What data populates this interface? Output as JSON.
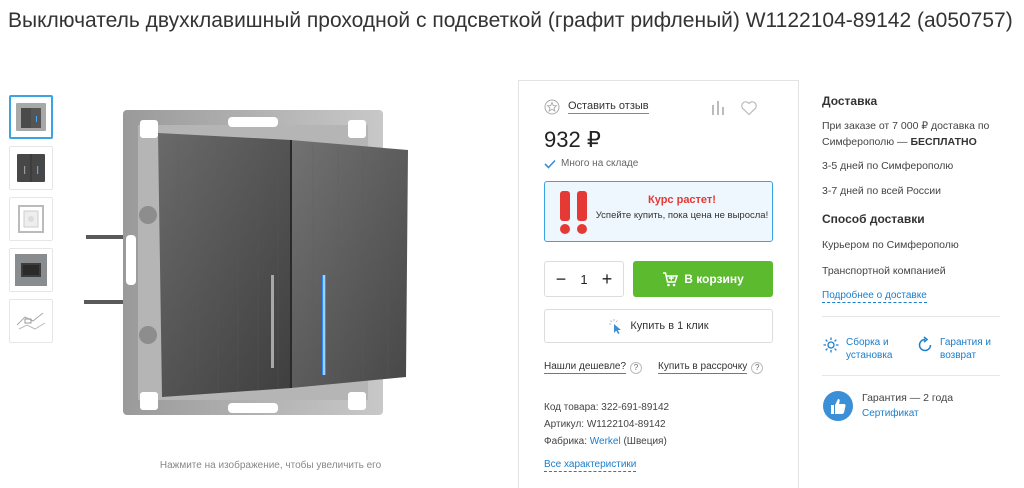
{
  "product": {
    "title": "Выключатель двухклавишный проходной с подсветкой (графит рифленый) W1122104-89142 (a050757)"
  },
  "gallery": {
    "thumbs": [
      "main-switch",
      "switch-front-lit",
      "frame-only",
      "switch-in-interior",
      "scheme"
    ],
    "active_index": 0,
    "caption": "Нажмите на изображение, чтобы увеличить его"
  },
  "buy": {
    "review_label": "Оставить отзыв",
    "price": "932 ₽",
    "stock": "Много на складе",
    "promo": {
      "title": "Курс растет!",
      "text": "Успейте купить, пока цена не выросла!"
    },
    "qty": "1",
    "minus": "−",
    "plus": "+",
    "cart_label": "В корзину",
    "oneclick_label": "Купить в 1 клик",
    "cheaper_label": "Нашли дешевле?",
    "installment_label": "Купить в рассрочку",
    "qmark": "?",
    "code_line": "Код товара: 322-691-89142",
    "article_line": "Артикул: W1122104-89142",
    "maker_prefix": "Фабрика: ",
    "maker_brand": "Werkel",
    "maker_country": " (Швеция)",
    "all_chars": "Все характеристики"
  },
  "delivery": {
    "title": "Доставка",
    "free_text": "При заказе от 7 000 ₽ доставка по Симферополю — ",
    "free_bold": "БЕСПЛАТНО",
    "line_city": "3-5 дней по Симферополю",
    "line_russia": "3-7 дней по всей России",
    "method_title": "Способ доставки",
    "method_courier": "Курьером по Симферополю",
    "method_transport": "Транспортной компанией",
    "more_link": "Подробнее о доставке",
    "assembly": "Сборка и установка",
    "warranty_return": "Гарантия и возврат",
    "warranty": "Гарантия — 2 года",
    "certificate": "Сертификат"
  },
  "colors": {
    "accent_blue": "#3aa3e3",
    "link_blue": "#1a7ecb",
    "cart_green": "#5cba2e",
    "promo_red": "#e53935"
  }
}
